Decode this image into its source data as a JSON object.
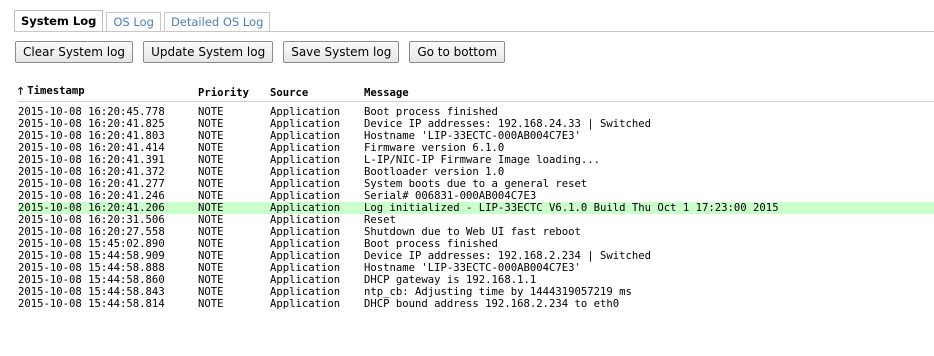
{
  "tabs": [
    {
      "label": "System Log",
      "active": true
    },
    {
      "label": "OS Log",
      "active": false
    },
    {
      "label": "Detailed OS Log",
      "active": false
    }
  ],
  "toolbar": {
    "clear_label": "Clear System log",
    "update_label": "Update System log",
    "save_label": "Save System log",
    "bottom_label": "Go to bottom"
  },
  "table": {
    "sort_icon": "arrow-up-icon",
    "columns": {
      "timestamp": "Timestamp",
      "priority": "Priority",
      "source": "Source",
      "message": "Message"
    },
    "highlight_color": "#ccffcc",
    "rows": [
      {
        "timestamp": "2015-10-08 16:20:45.778",
        "priority": "NOTE",
        "source": "Application",
        "message": "Boot process finished",
        "highlight": false
      },
      {
        "timestamp": "2015-10-08 16:20:41.825",
        "priority": "NOTE",
        "source": "Application",
        "message": "Device IP addresses: 192.168.24.33 | Switched",
        "highlight": false
      },
      {
        "timestamp": "2015-10-08 16:20:41.803",
        "priority": "NOTE",
        "source": "Application",
        "message": "Hostname 'LIP-33ECTC-000AB004C7E3'",
        "highlight": false
      },
      {
        "timestamp": "2015-10-08 16:20:41.414",
        "priority": "NOTE",
        "source": "Application",
        "message": "Firmware version 6.1.0",
        "highlight": false
      },
      {
        "timestamp": "2015-10-08 16:20:41.391",
        "priority": "NOTE",
        "source": "Application",
        "message": "L-IP/NIC-IP Firmware Image loading...",
        "highlight": false
      },
      {
        "timestamp": "2015-10-08 16:20:41.372",
        "priority": "NOTE",
        "source": "Application",
        "message": "Bootloader version 1.0",
        "highlight": false
      },
      {
        "timestamp": "2015-10-08 16:20:41.277",
        "priority": "NOTE",
        "source": "Application",
        "message": "System boots due to a general reset",
        "highlight": false
      },
      {
        "timestamp": "2015-10-08 16:20:41.246",
        "priority": "NOTE",
        "source": "Application",
        "message": "Serial# 006831-000AB004C7E3",
        "highlight": false
      },
      {
        "timestamp": "2015-10-08 16:20:41.206",
        "priority": "NOTE",
        "source": "Application",
        "message": "Log initialized - LIP-33ECTC V6.1.0 Build Thu Oct 1 17:23:00 2015",
        "highlight": true
      },
      {
        "timestamp": "2015-10-08 16:20:31.506",
        "priority": "NOTE",
        "source": "Application",
        "message": "Reset",
        "highlight": false
      },
      {
        "timestamp": "2015-10-08 16:20:27.558",
        "priority": "NOTE",
        "source": "Application",
        "message": "Shutdown due to Web UI fast reboot",
        "highlight": false
      },
      {
        "timestamp": "2015-10-08 15:45:02.890",
        "priority": "NOTE",
        "source": "Application",
        "message": "Boot process finished",
        "highlight": false
      },
      {
        "timestamp": "2015-10-08 15:44:58.909",
        "priority": "NOTE",
        "source": "Application",
        "message": "Device IP addresses: 192.168.2.234 | Switched",
        "highlight": false
      },
      {
        "timestamp": "2015-10-08 15:44:58.888",
        "priority": "NOTE",
        "source": "Application",
        "message": "Hostname 'LIP-33ECTC-000AB004C7E3'",
        "highlight": false
      },
      {
        "timestamp": "2015-10-08 15:44:58.860",
        "priority": "NOTE",
        "source": "Application",
        "message": "DHCP gateway is 192.168.1.1",
        "highlight": false
      },
      {
        "timestamp": "2015-10-08 15:44:58.843",
        "priority": "NOTE",
        "source": "Application",
        "message": "ntp_cb: Adjusting time by 1444319057219 ms",
        "highlight": false
      },
      {
        "timestamp": "2015-10-08 15:44:58.814",
        "priority": "NOTE",
        "source": "Application",
        "message": "DHCP bound address 192.168.2.234 to eth0",
        "highlight": false
      }
    ]
  }
}
